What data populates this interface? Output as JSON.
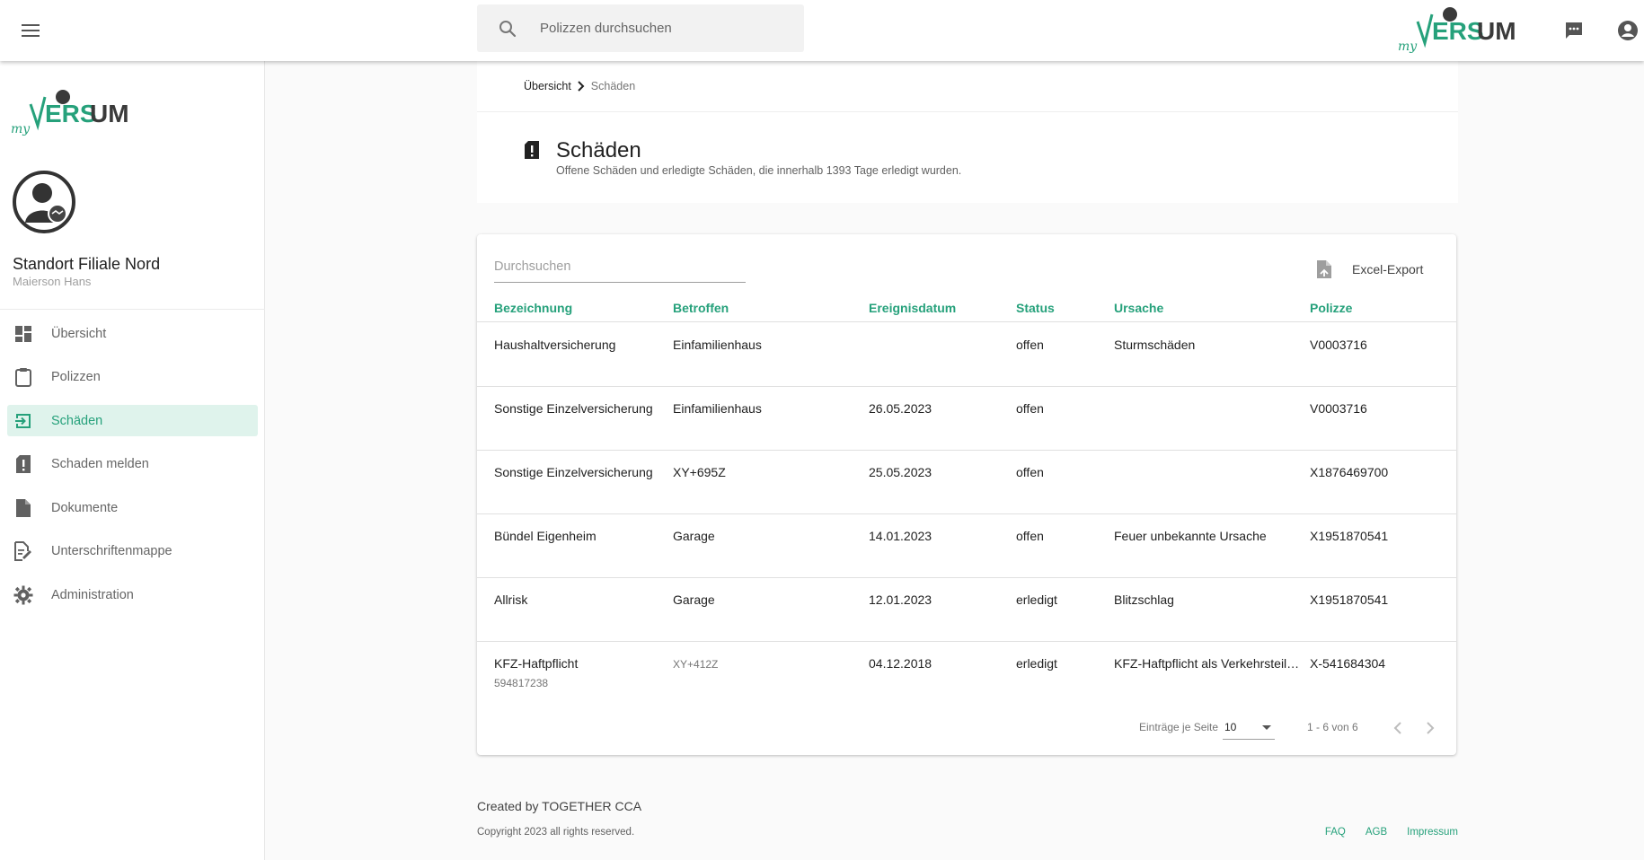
{
  "brand": {
    "logo_text": "VERSUM",
    "logo_prefix": "my",
    "accent_color": "#26a17b"
  },
  "topbar": {
    "search_placeholder": "Polizzen durchsuchen"
  },
  "sidebar": {
    "user_name": "Standort Filiale Nord",
    "user_sub": "Maierson Hans",
    "items": [
      {
        "label": "Übersicht",
        "icon": "dashboard-icon",
        "active": false
      },
      {
        "label": "Polizzen",
        "icon": "clipboard-icon",
        "active": false
      },
      {
        "label": "Schäden",
        "icon": "exit-to-app-icon",
        "active": true
      },
      {
        "label": "Schaden melden",
        "icon": "report-icon",
        "active": false
      },
      {
        "label": "Dokumente",
        "icon": "document-icon",
        "active": false
      },
      {
        "label": "Unterschriftenmappe",
        "icon": "signature-icon",
        "active": false
      },
      {
        "label": "Administration",
        "icon": "gear-icon",
        "active": false
      }
    ]
  },
  "header": {
    "breadcrumb_home": "Übersicht",
    "breadcrumb_current": "Schäden",
    "title": "Schäden",
    "subtitle": "Offene Schäden und erledigte Schäden, die innerhalb 1393 Tage erledigt wurden."
  },
  "table": {
    "filter_placeholder": "Durchsuchen",
    "export_label": "Excel-Export",
    "columns": [
      "Bezeichnung",
      "Betroffen",
      "Ereignisdatum",
      "Status",
      "Ursache",
      "Polizze"
    ],
    "rows": [
      {
        "bezeichnung": "Haushaltversicherung",
        "sub": "",
        "betroffen": "Einfamilienhaus",
        "datum": "",
        "status": "offen",
        "ursache": "Sturmschäden",
        "polizze": "V0003716"
      },
      {
        "bezeichnung": "Sonstige Einzelversicherung",
        "sub": "",
        "betroffen": "Einfamilienhaus",
        "datum": "26.05.2023",
        "status": "offen",
        "ursache": "",
        "polizze": "V0003716"
      },
      {
        "bezeichnung": "Sonstige Einzelversicherung",
        "sub": "",
        "betroffen": "XY+695Z",
        "datum": "25.05.2023",
        "status": "offen",
        "ursache": "",
        "polizze": "X1876469700"
      },
      {
        "bezeichnung": "Bündel Eigenheim",
        "sub": "",
        "betroffen": "Garage",
        "datum": "14.01.2023",
        "status": "offen",
        "ursache": "Feuer unbekannte Ursache",
        "polizze": "X1951870541"
      },
      {
        "bezeichnung": "Allrisk",
        "sub": "",
        "betroffen": "Garage",
        "datum": "12.01.2023",
        "status": "erledigt",
        "ursache": "Blitzschlag",
        "polizze": "X1951870541"
      },
      {
        "bezeichnung": "KFZ-Haftpflicht",
        "sub": "594817238",
        "betroffen": "XY+412Z",
        "datum": "04.12.2018",
        "status": "erledigt",
        "ursache": "KFZ-Haftpflicht als Verkehrsteilnehmer",
        "polizze": "X-541684304"
      }
    ],
    "paginator": {
      "label": "Einträge je Seite",
      "page_size": "10",
      "range": "1 - 6 von 6"
    }
  },
  "footer": {
    "created": "Created by TOGETHER CCA",
    "copyright": "Copyright 2023 all rights reserved.",
    "links": [
      "FAQ",
      "AGB",
      "Impressum"
    ]
  }
}
